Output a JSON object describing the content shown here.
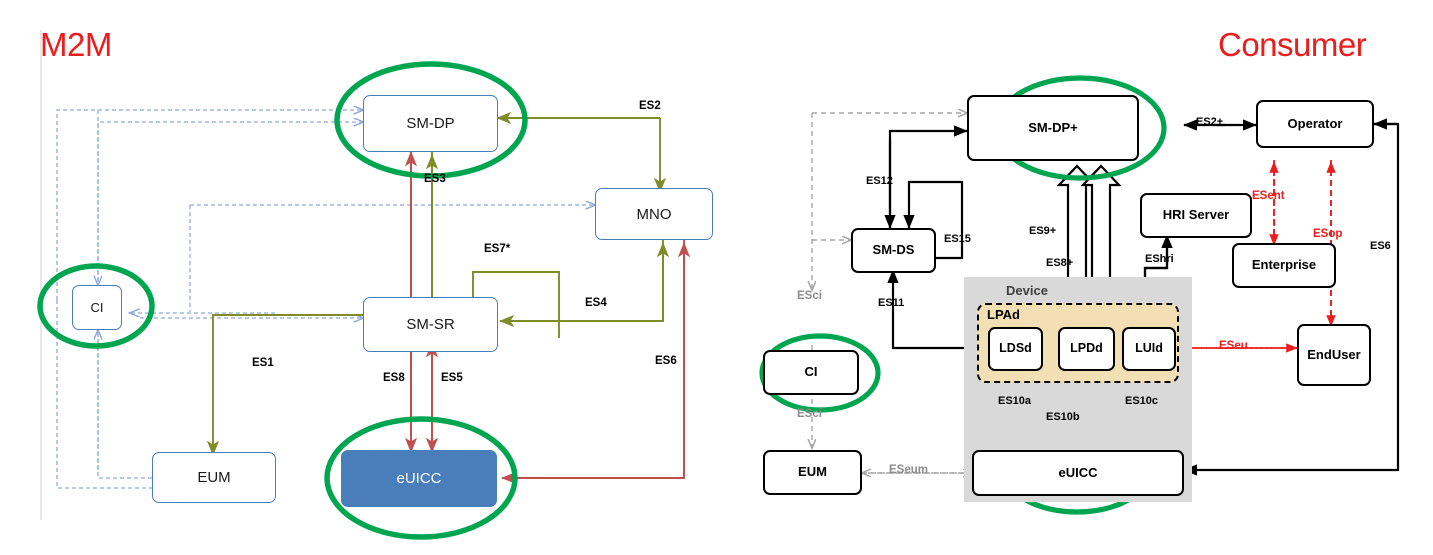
{
  "titles": {
    "left": "M2M",
    "right": "Consumer",
    "color": "#ee1c1c"
  },
  "palette": {
    "box_blue": "#4a7ebb",
    "euicc_fill": "#4a7ebb",
    "green_highlight": "#00a54f",
    "olive_arrow": "#7e8c2a",
    "red_arrow": "#c0504d",
    "dashed_blue": "#8faadc",
    "device_gray": "#d9d9d9",
    "lpad_tan": "#f2dfb3",
    "black": "#000000",
    "gray_dashed": "#a6a6a6"
  },
  "m2m": {
    "nodes": [
      {
        "id": "sm-dp",
        "label": "SM-DP",
        "highlighted": true,
        "filled": false
      },
      {
        "id": "mno",
        "label": "MNO",
        "highlighted": false,
        "filled": false
      },
      {
        "id": "ci",
        "label": "CI",
        "highlighted": true,
        "filled": false
      },
      {
        "id": "sm-sr",
        "label": "SM-SR",
        "highlighted": false,
        "filled": false
      },
      {
        "id": "eum",
        "label": "EUM",
        "highlighted": false,
        "filled": false
      },
      {
        "id": "euicc",
        "label": "eUICC",
        "highlighted": true,
        "filled": true
      }
    ],
    "edge_labels": [
      {
        "id": "es2",
        "text": "ES2",
        "kind": "olive"
      },
      {
        "id": "es3",
        "text": "ES3",
        "kind": "olive"
      },
      {
        "id": "es7",
        "text": "ES7*",
        "kind": "olive"
      },
      {
        "id": "es4",
        "text": "ES4",
        "kind": "olive"
      },
      {
        "id": "es1",
        "text": "ES1",
        "kind": "olive"
      },
      {
        "id": "es8",
        "text": "ES8",
        "kind": "red"
      },
      {
        "id": "es5",
        "text": "ES5",
        "kind": "red"
      },
      {
        "id": "es6",
        "text": "ES6",
        "kind": "red"
      }
    ]
  },
  "consumer": {
    "nodes": [
      {
        "id": "sm-dp-plus",
        "label": "SM-DP+",
        "highlighted": true
      },
      {
        "id": "operator",
        "label": "Operator",
        "highlighted": false
      },
      {
        "id": "sm-ds",
        "label": "SM-DS",
        "highlighted": false
      },
      {
        "id": "hri-server",
        "label": "HRI Server",
        "highlighted": false
      },
      {
        "id": "enterprise",
        "label": "Enterprise",
        "highlighted": false
      },
      {
        "id": "ci",
        "label": "CI",
        "highlighted": true
      },
      {
        "id": "end-user",
        "label": "End\nUser",
        "label_line1": "End",
        "label_line2": "User",
        "highlighted": false
      },
      {
        "id": "eum",
        "label": "EUM",
        "highlighted": false
      },
      {
        "id": "ldsd",
        "label": "LDSd",
        "highlighted": false
      },
      {
        "id": "lpdd",
        "label": "LPDd",
        "highlighted": false
      },
      {
        "id": "luid",
        "label": "LUId",
        "highlighted": false
      },
      {
        "id": "euicc",
        "label": "eUICC",
        "highlighted": true
      }
    ],
    "containers": [
      {
        "id": "device",
        "label": "Device"
      },
      {
        "id": "lpad",
        "label": "LPAd"
      }
    ],
    "edge_labels": [
      {
        "id": "es2plus",
        "text": "ES2+",
        "kind": "black"
      },
      {
        "id": "es12",
        "text": "ES12",
        "kind": "black"
      },
      {
        "id": "es15",
        "text": "ES15",
        "kind": "black"
      },
      {
        "id": "es11",
        "text": "ES11",
        "kind": "black"
      },
      {
        "id": "es9plus",
        "text": "ES9+",
        "kind": "black"
      },
      {
        "id": "es8plus",
        "text": "ES8+",
        "kind": "black"
      },
      {
        "id": "eshri",
        "text": "EShri",
        "kind": "black"
      },
      {
        "id": "es10a",
        "text": "ES10a",
        "kind": "black"
      },
      {
        "id": "es10b",
        "text": "ES10b",
        "kind": "black"
      },
      {
        "id": "es10c",
        "text": "ES10c",
        "kind": "black"
      },
      {
        "id": "es6",
        "text": "ES6",
        "kind": "black"
      },
      {
        "id": "esent",
        "text": "ESent",
        "kind": "red"
      },
      {
        "id": "esop",
        "text": "ESop",
        "kind": "red"
      },
      {
        "id": "eseu",
        "text": "ESeu",
        "kind": "red"
      },
      {
        "id": "esci_top",
        "text": "ESci",
        "kind": "gray"
      },
      {
        "id": "esci_bot",
        "text": "ESci",
        "kind": "gray"
      },
      {
        "id": "eseum",
        "text": "ESeum",
        "kind": "gray"
      }
    ]
  }
}
